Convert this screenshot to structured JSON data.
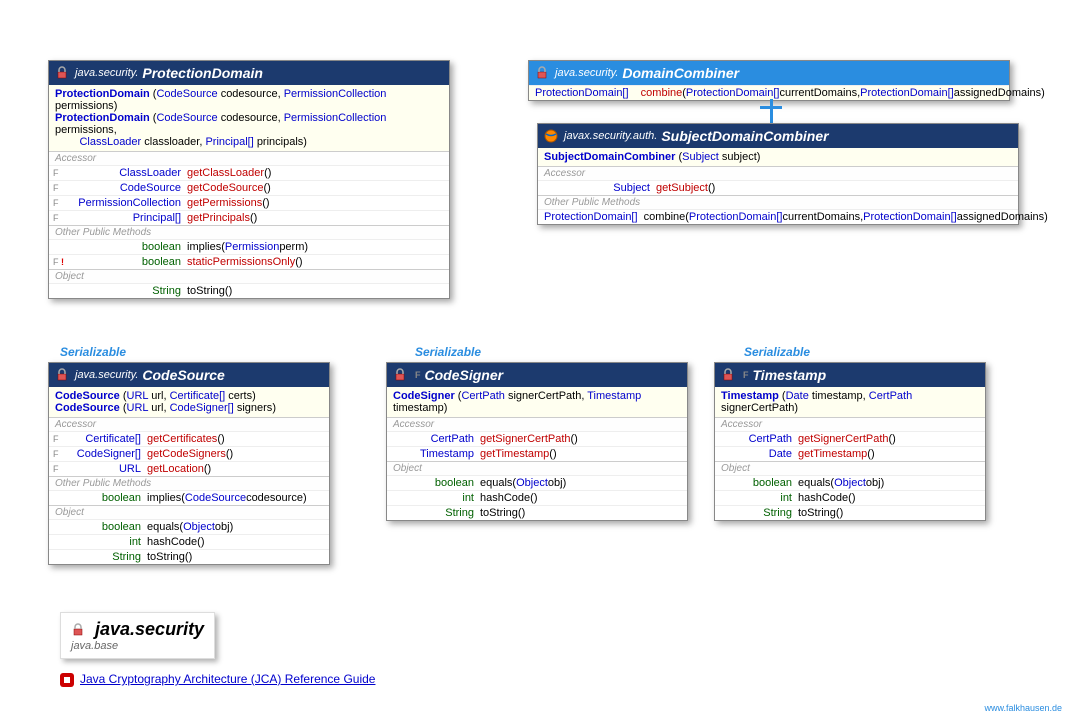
{
  "classes": {
    "protectionDomain": {
      "pkg": "java.security.",
      "name": "ProtectionDomain",
      "constructors": [
        {
          "name": "ProtectionDomain",
          "params": [
            [
              "CodeSource",
              "codesource"
            ],
            [
              "PermissionCollection",
              "permissions"
            ]
          ]
        },
        {
          "name": "ProtectionDomain",
          "params": [
            [
              "CodeSource",
              "codesource"
            ],
            [
              "PermissionCollection",
              "permissions"
            ],
            [
              "ClassLoader",
              "classloader"
            ],
            [
              "Principal[]",
              "principals"
            ]
          ]
        }
      ],
      "sections": {
        "accessor": "Accessor",
        "other": "Other Public Methods",
        "object": "Object"
      },
      "accessors": [
        {
          "mod": "F",
          "rtype": "ClassLoader",
          "name": "getClassLoader",
          "params": "()"
        },
        {
          "mod": "F",
          "rtype": "CodeSource",
          "name": "getCodeSource",
          "params": "()"
        },
        {
          "mod": "F",
          "rtype": "PermissionCollection",
          "name": "getPermissions",
          "params": "()"
        },
        {
          "mod": "F",
          "rtype": "Principal[]",
          "name": "getPrincipals",
          "params": "()"
        }
      ],
      "others": [
        {
          "mod": "",
          "rtype": "boolean",
          "name": "implies",
          "params": "(Permission perm)",
          "black": true,
          "paramtypes": [
            [
              "Permission",
              "perm"
            ]
          ]
        },
        {
          "mod": "F !",
          "rtype": "boolean",
          "name": "staticPermissionsOnly",
          "params": "()"
        }
      ],
      "objectMethods": [
        {
          "rtype": "String",
          "name": "toString",
          "params": "()"
        }
      ]
    },
    "domainCombiner": {
      "pkg": "java.security.",
      "name": "DomainCombiner",
      "method": {
        "rtype": "ProtectionDomain[]",
        "name": "combine",
        "params": [
          [
            "ProtectionDomain[]",
            "currentDomains"
          ],
          [
            "ProtectionDomain[]",
            "assignedDomains"
          ]
        ]
      }
    },
    "subjectDomainCombiner": {
      "pkg": "javax.security.auth.",
      "name": "SubjectDomainCombiner",
      "constructor": {
        "name": "SubjectDomainCombiner",
        "params": [
          [
            "Subject",
            "subject"
          ]
        ]
      },
      "sections": {
        "accessor": "Accessor",
        "other": "Other Public Methods"
      },
      "accessor": {
        "rtype": "Subject",
        "name": "getSubject",
        "params": "()"
      },
      "other": {
        "rtype": "ProtectionDomain[]",
        "name": "combine",
        "params": [
          [
            "ProtectionDomain[]",
            "currentDomains"
          ],
          [
            "ProtectionDomain[]",
            "assignedDomains"
          ]
        ]
      }
    },
    "codeSource": {
      "pkg": "java.security.",
      "name": "CodeSource",
      "serializable": "Serializable",
      "constructors": [
        {
          "name": "CodeSource",
          "params": [
            [
              "URL",
              "url"
            ],
            [
              "Certificate[]",
              "certs"
            ]
          ]
        },
        {
          "name": "CodeSource",
          "params": [
            [
              "URL",
              "url"
            ],
            [
              "CodeSigner[]",
              "signers"
            ]
          ]
        }
      ],
      "sections": {
        "accessor": "Accessor",
        "other": "Other Public Methods",
        "object": "Object"
      },
      "accessors": [
        {
          "mod": "F",
          "rtype": "Certificate[]",
          "name": "getCertificates",
          "params": "()"
        },
        {
          "mod": "F",
          "rtype": "CodeSigner[]",
          "name": "getCodeSigners",
          "params": "()"
        },
        {
          "mod": "F",
          "rtype": "URL",
          "name": "getLocation",
          "params": "()"
        }
      ],
      "others": [
        {
          "rtype": "boolean",
          "name": "implies",
          "paramtypes": [
            [
              "CodeSource",
              "codesource"
            ]
          ]
        }
      ],
      "objectMethods": [
        {
          "rtype": "boolean",
          "name": "equals",
          "paramtypes": [
            [
              "Object",
              "obj"
            ]
          ]
        },
        {
          "rtype": "int",
          "name": "hashCode",
          "params": "()"
        },
        {
          "rtype": "String",
          "name": "toString",
          "params": "()"
        }
      ]
    },
    "codeSigner": {
      "name": "CodeSigner",
      "serializable": "Serializable",
      "hasF": "F",
      "constructor": {
        "name": "CodeSigner",
        "params": [
          [
            "CertPath",
            "signerCertPath"
          ],
          [
            "Timestamp",
            "timestamp"
          ]
        ]
      },
      "sections": {
        "accessor": "Accessor",
        "object": "Object"
      },
      "accessors": [
        {
          "rtype": "CertPath",
          "name": "getSignerCertPath",
          "params": "()"
        },
        {
          "rtype": "Timestamp",
          "name": "getTimestamp",
          "params": "()"
        }
      ],
      "objectMethods": [
        {
          "rtype": "boolean",
          "name": "equals",
          "paramtypes": [
            [
              "Object",
              "obj"
            ]
          ]
        },
        {
          "rtype": "int",
          "name": "hashCode",
          "params": "()"
        },
        {
          "rtype": "String",
          "name": "toString",
          "params": "()"
        }
      ]
    },
    "timestamp": {
      "name": "Timestamp",
      "serializable": "Serializable",
      "hasF": "F",
      "constructor": {
        "name": "Timestamp",
        "params": [
          [
            "Date",
            "timestamp"
          ],
          [
            "CertPath",
            "signerCertPath"
          ]
        ]
      },
      "sections": {
        "accessor": "Accessor",
        "object": "Object"
      },
      "accessors": [
        {
          "rtype": "CertPath",
          "name": "getSignerCertPath",
          "params": "()"
        },
        {
          "rtype": "Date",
          "name": "getTimestamp",
          "params": "()"
        }
      ],
      "objectMethods": [
        {
          "rtype": "boolean",
          "name": "equals",
          "paramtypes": [
            [
              "Object",
              "obj"
            ]
          ]
        },
        {
          "rtype": "int",
          "name": "hashCode",
          "params": "()"
        },
        {
          "rtype": "String",
          "name": "toString",
          "params": "()"
        }
      ]
    }
  },
  "footer": {
    "title": "java.security",
    "module": "java.base",
    "refLink": "Java Cryptography Architecture (JCA) Reference Guide"
  },
  "watermark": "www.falkhausen.de"
}
